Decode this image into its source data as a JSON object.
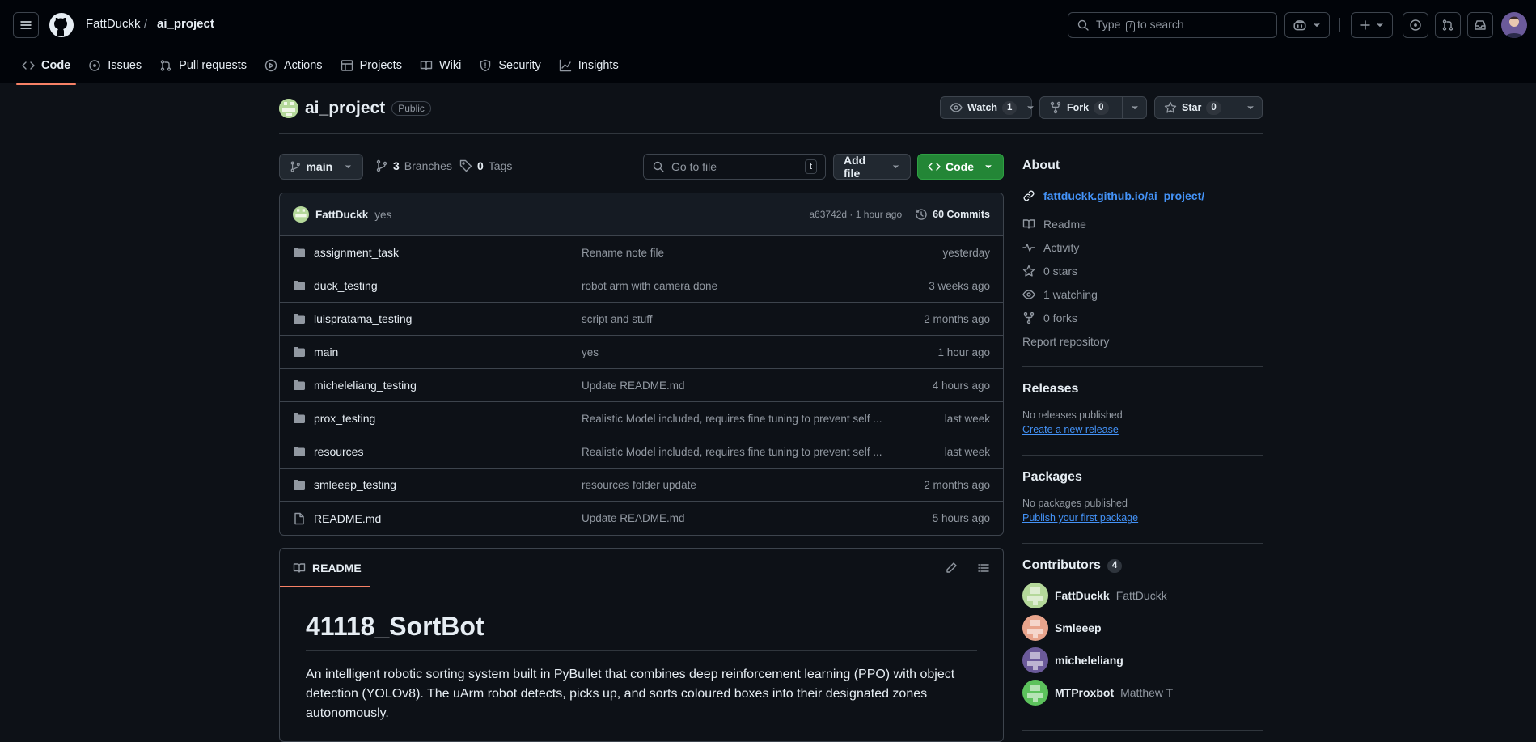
{
  "header": {
    "owner": "FattDuckk",
    "slash": "/",
    "repo": "ai_project",
    "search_prefix": "Type",
    "search_key": "/",
    "search_suffix": "to search"
  },
  "tabs": [
    {
      "label": "Code",
      "icon": "code-icon"
    },
    {
      "label": "Issues",
      "icon": "issue-icon"
    },
    {
      "label": "Pull requests",
      "icon": "pull-request-icon"
    },
    {
      "label": "Actions",
      "icon": "play-icon"
    },
    {
      "label": "Projects",
      "icon": "table-icon"
    },
    {
      "label": "Wiki",
      "icon": "book-icon"
    },
    {
      "label": "Security",
      "icon": "shield-icon"
    },
    {
      "label": "Insights",
      "icon": "graph-icon"
    }
  ],
  "repo": {
    "name": "ai_project",
    "visibility": "Public",
    "watch_label": "Watch",
    "watch_count": "1",
    "fork_label": "Fork",
    "fork_count": "0",
    "star_label": "Star",
    "star_count": "0"
  },
  "toolbar": {
    "branch": "main",
    "branches_count": "3",
    "branches_label": "Branches",
    "tags_count": "0",
    "tags_label": "Tags",
    "goto_placeholder": "Go to file",
    "goto_key": "t",
    "add_file": "Add file",
    "code": "Code"
  },
  "commit": {
    "author": "FattDuckk",
    "message": "yes",
    "meta": "a63742d · 1 hour ago",
    "commits": "60 Commits"
  },
  "files": [
    {
      "name": "assignment_task",
      "type": "folder",
      "message": "Rename note file",
      "time": "yesterday"
    },
    {
      "name": "duck_testing",
      "type": "folder",
      "message": "robot arm with camera done",
      "time": "3 weeks ago"
    },
    {
      "name": "luispratama_testing",
      "type": "folder",
      "message": "script and stuff",
      "time": "2 months ago"
    },
    {
      "name": "main",
      "type": "folder",
      "message": "yes",
      "time": "1 hour ago"
    },
    {
      "name": "micheleliang_testing",
      "type": "folder",
      "message": "Update README.md",
      "time": "4 hours ago"
    },
    {
      "name": "prox_testing",
      "type": "folder",
      "message": "Realistic Model included, requires fine tuning to prevent self ...",
      "time": "last week"
    },
    {
      "name": "resources",
      "type": "folder",
      "message": "Realistic Model included, requires fine tuning to prevent self ...",
      "time": "last week"
    },
    {
      "name": "smleeep_testing",
      "type": "folder",
      "message": "resources folder update",
      "time": "2 months ago"
    },
    {
      "name": "README.md",
      "type": "file",
      "message": "Update README.md",
      "time": "5 hours ago"
    }
  ],
  "readme": {
    "tab": "README",
    "title": "41118_SortBot",
    "body": "An intelligent robotic sorting system built in PyBullet that combines deep reinforcement learning (PPO) with object detection (YOLOv8). The uArm robot detects, picks up, and sorts coloured boxes into their designated zones autonomously."
  },
  "about": {
    "heading": "About",
    "website": "fattduckk.github.io/ai_project/",
    "readme": "Readme",
    "activity": "Activity",
    "stars": "0 stars",
    "watching": "1 watching",
    "forks": "0 forks",
    "report": "Report repository"
  },
  "releases": {
    "heading": "Releases",
    "empty": "No releases published",
    "link": "Create a new release"
  },
  "packages": {
    "heading": "Packages",
    "empty": "No packages published",
    "link": "Publish your first package"
  },
  "contributors": {
    "heading": "Contributors",
    "count": "4",
    "people": [
      {
        "login": "FattDuckk",
        "name": "FattDuckk",
        "color": "#b4d89a"
      },
      {
        "login": "Smleeep",
        "name": "",
        "color": "#e8a48c"
      },
      {
        "login": "micheleliang",
        "name": "",
        "color": "#6b5a9a"
      },
      {
        "login": "MTProxbot",
        "name": "Matthew T",
        "color": "#5cc25c"
      }
    ]
  },
  "colors": {
    "accent": "#f78166",
    "link": "#4493f8",
    "green": "#238636"
  }
}
